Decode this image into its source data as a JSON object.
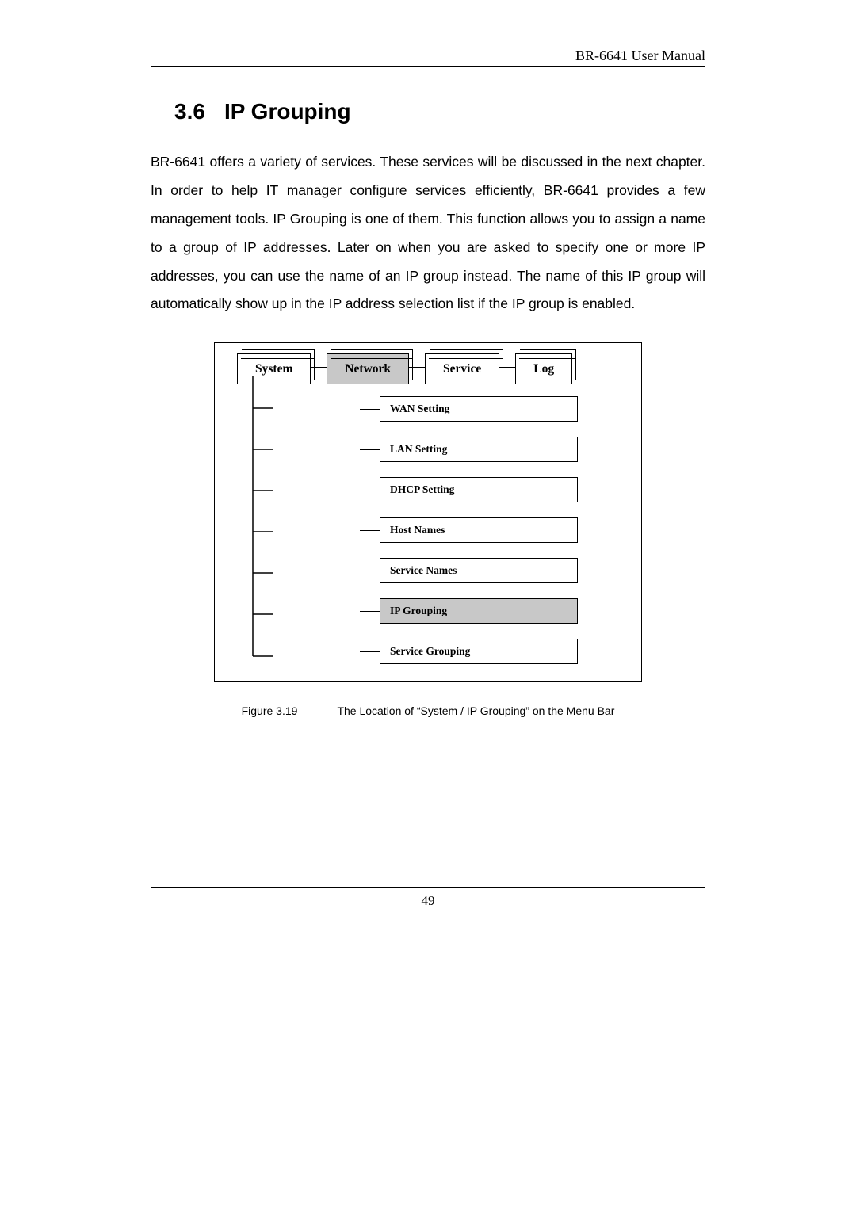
{
  "header": {
    "doc_title": "BR-6641 User Manual"
  },
  "section": {
    "number": "3.6",
    "title": "IP Grouping"
  },
  "body": "BR-6641 offers a variety of services. These services will be discussed in the next chapter. In order to help IT manager configure services efficiently, BR-6641 provides a few management tools. IP Grouping is one of them. This function allows you to assign a name to a group of IP addresses. Later on when you are asked to specify one or more IP addresses, you can use the name of an IP group instead. The name of this IP group will automatically show up in the IP address selection list if the IP group is enabled.",
  "diagram": {
    "top_menu": [
      {
        "label": "System",
        "active": false
      },
      {
        "label": "Network",
        "active": true
      },
      {
        "label": "Service",
        "active": false
      },
      {
        "label": "Log",
        "active": false
      }
    ],
    "submenu": [
      {
        "label": "WAN Setting",
        "active": false
      },
      {
        "label": "LAN Setting",
        "active": false
      },
      {
        "label": "DHCP Setting",
        "active": false
      },
      {
        "label": "Host Names",
        "active": false
      },
      {
        "label": "Service Names",
        "active": false
      },
      {
        "label": "IP Grouping",
        "active": true
      },
      {
        "label": "Service Grouping",
        "active": false
      }
    ]
  },
  "figure": {
    "label": "Figure 3.19",
    "caption": "The Location of “System / IP Grouping” on the Menu Bar"
  },
  "page_number": "49"
}
